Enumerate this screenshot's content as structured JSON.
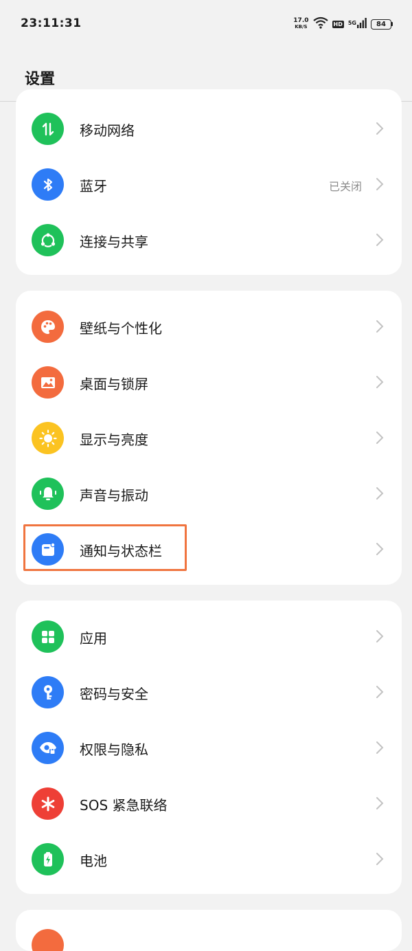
{
  "status_bar": {
    "time": "23:11:31",
    "net_speed": "17.0",
    "net_unit": "KB/S",
    "hd": "HD",
    "network_type": "5G",
    "battery": "84"
  },
  "header": {
    "title": "设置"
  },
  "cards": [
    {
      "items": [
        {
          "label": "移动网络",
          "value": "",
          "icon": "mobile-data-icon",
          "color": "#1fc15a"
        },
        {
          "label": "蓝牙",
          "value": "已关闭",
          "icon": "bluetooth-icon",
          "color": "#2e7cf6"
        },
        {
          "label": "连接与共享",
          "value": "",
          "icon": "share-icon",
          "color": "#1fc15a"
        }
      ]
    },
    {
      "items": [
        {
          "label": "壁纸与个性化",
          "value": "",
          "icon": "palette-icon",
          "color": "#f36b3e"
        },
        {
          "label": "桌面与锁屏",
          "value": "",
          "icon": "picture-icon",
          "color": "#f36b3e"
        },
        {
          "label": "显示与亮度",
          "value": "",
          "icon": "sun-icon",
          "color": "#fbc321"
        },
        {
          "label": "声音与振动",
          "value": "",
          "icon": "bell-icon",
          "color": "#1fc15a"
        },
        {
          "label": "通知与状态栏",
          "value": "",
          "icon": "notification-icon",
          "color": "#2e7cf6"
        }
      ]
    },
    {
      "items": [
        {
          "label": "应用",
          "value": "",
          "icon": "apps-icon",
          "color": "#1fc15a"
        },
        {
          "label": "密码与安全",
          "value": "",
          "icon": "key-icon",
          "color": "#2e7cf6"
        },
        {
          "label": "权限与隐私",
          "value": "",
          "icon": "privacy-eye-icon",
          "color": "#2e7cf6"
        },
        {
          "label": "SOS 紧急联络",
          "value": "",
          "icon": "sos-asterisk-icon",
          "color": "#ee3f36"
        },
        {
          "label": "电池",
          "value": "",
          "icon": "battery-icon",
          "color": "#1fc15a"
        }
      ]
    }
  ]
}
